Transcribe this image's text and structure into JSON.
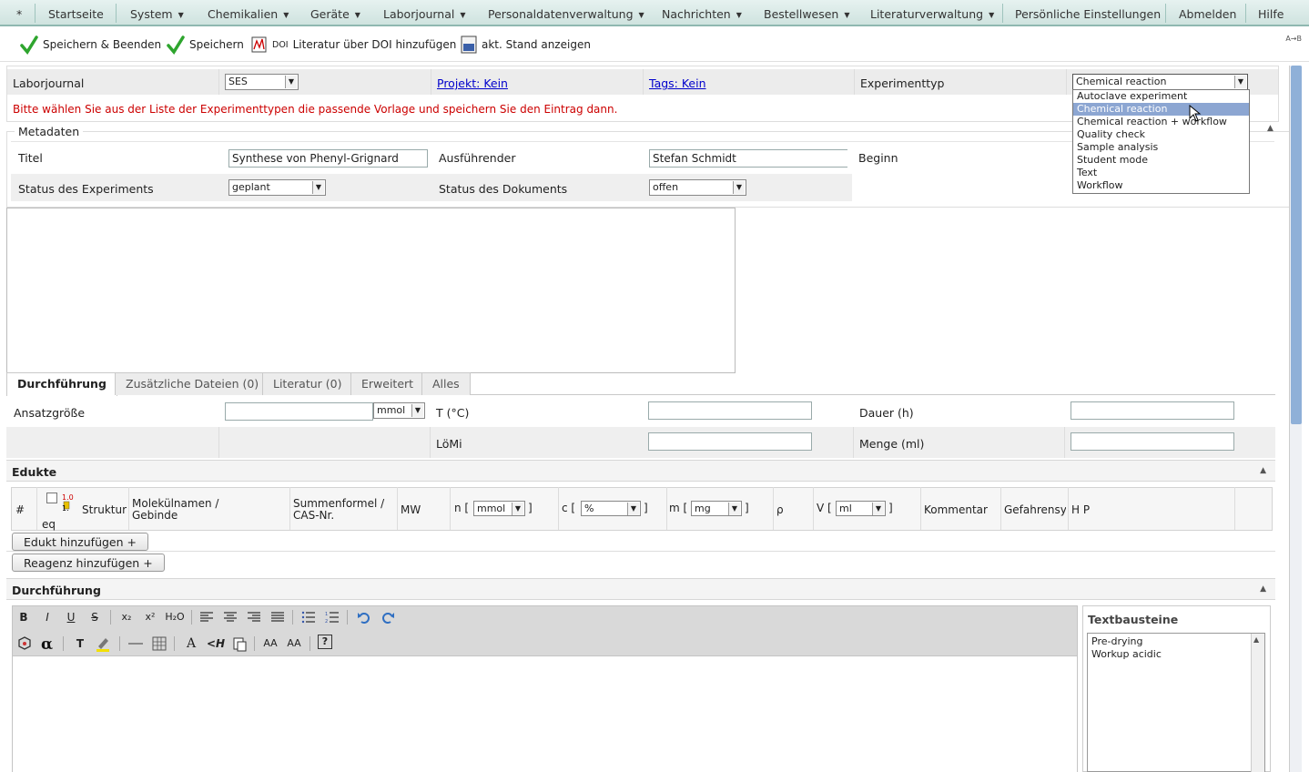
{
  "menubar": {
    "star": "*",
    "items": [
      {
        "label": "Startseite",
        "has_arrow": false
      },
      {
        "label": "System",
        "has_arrow": true
      },
      {
        "label": "Chemikalien",
        "has_arrow": true
      },
      {
        "label": "Geräte",
        "has_arrow": true
      },
      {
        "label": "Laborjournal",
        "has_arrow": true
      },
      {
        "label": "Personaldatenverwaltung",
        "has_arrow": true
      },
      {
        "label": "Nachrichten",
        "has_arrow": true
      },
      {
        "label": "Bestellwesen",
        "has_arrow": true
      },
      {
        "label": "Literaturverwaltung",
        "has_arrow": true
      },
      {
        "label": "Persönliche Einstellungen",
        "has_arrow": false
      },
      {
        "label": "Abmelden",
        "has_arrow": false
      },
      {
        "label": "Hilfe",
        "has_arrow": false
      }
    ],
    "arrow_glyph": "▼"
  },
  "toolbar": {
    "save_close": "Speichern & Beenden",
    "save": "Speichern",
    "doi_prefix": "DOI",
    "doi_label": "Literatur über DOI hinzufügen",
    "pdf_badge": "PDF",
    "current_state": "akt. Stand anzeigen",
    "corner": "A→B"
  },
  "header_row": {
    "labor_label": "Laborjournal",
    "labor_value": "SES",
    "project_link": "Projekt: Kein",
    "tags_link": "Tags: Kein",
    "exptype_label": "Experimenttyp",
    "exptype_value": "Chemical reaction",
    "warning": "Bitte wählen Sie aus der Liste der Experimenttypen die passende Vorlage und speichern Sie den Eintrag dann."
  },
  "exptype_options": [
    "Autoclave experiment",
    "Chemical reaction",
    "Chemical reaction + workflow",
    "Quality check",
    "Sample analysis",
    "Student mode",
    "Text",
    "Workflow"
  ],
  "metadata": {
    "legend": "Metadaten",
    "title_label": "Titel",
    "title_value": "Synthese von Phenyl-Grignard",
    "performer_label": "Ausführender",
    "performer_value": "Stefan Schmidt",
    "begin_label": "Beginn",
    "status_exp_label": "Status des Experiments",
    "status_exp_value": "geplant",
    "status_doc_label": "Status des Dokuments",
    "status_doc_value": "offen"
  },
  "tabs": [
    "Durchführung",
    "Zusätzliche Dateien (0)",
    "Literatur (0)",
    "Erweitert",
    "Alles"
  ],
  "params": {
    "ansatz_label": "Ansatzgröße",
    "ansatz_unit": "mmol",
    "temp_label": "T (°C)",
    "duration_label": "Dauer (h)",
    "solvent_label": "LöMi",
    "amount_label": "Menge (ml)"
  },
  "edukte": {
    "title": "Edukte",
    "cols": {
      "hash": "#",
      "eq": "eq",
      "struct": "Struktur",
      "names_line1": "Molekülnamen /",
      "names_line2": "Gebinde",
      "formula_line1": "Summenformel /",
      "formula_line2": "CAS-Nr.",
      "mw": "MW",
      "n_prefix": "n [",
      "n_unit": "mmol",
      "c_prefix": "c [",
      "c_unit": "%",
      "m_prefix": "m [",
      "m_unit": "mg",
      "rho": "ρ",
      "v_prefix": "V [",
      "v_unit": "ml",
      "bracket_close": "]",
      "comment": "Kommentar",
      "hazard": "Gefahrensym",
      "hp": "H P"
    },
    "add_educt": "Edukt hinzufügen +",
    "add_reagent": "Reagenz hinzufügen +"
  },
  "procedure": {
    "title": "Durchführung",
    "text_blocks_title": "Textbausteine",
    "text_blocks": [
      "Pre-drying",
      "Workup acidic"
    ],
    "editor_buttons_row1": [
      "B",
      "I",
      "U",
      "S",
      "x₂",
      "x²",
      "H₂O"
    ],
    "editor_row2_labels": [
      "T",
      "A",
      "<H",
      "AA",
      "AA",
      "?"
    ]
  },
  "colors": {
    "menu_bg": "#d8ebe7",
    "accent": "#8fb8b0",
    "warning_text": "#cc0000",
    "dropdown_selected": "#8ca6d2",
    "link": "#0000cc",
    "check_green": "#2ea52e"
  }
}
